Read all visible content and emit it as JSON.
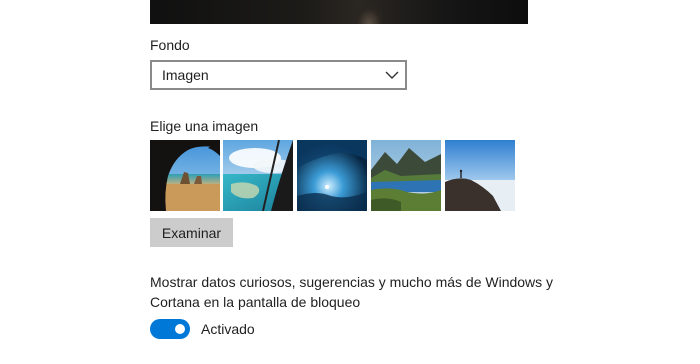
{
  "background": {
    "label": "Fondo",
    "selected": "Imagen"
  },
  "choose_image": {
    "label": "Elige una imagen",
    "thumbnails": [
      "cave-beach",
      "aerial-coast",
      "ice-cave",
      "mountain-lake",
      "sea-cliff"
    ]
  },
  "browse_button": "Examinar",
  "tips": {
    "description": "Mostrar datos curiosos, sugerencias y mucho más de Windows y Cortana en la pantalla de bloqueo",
    "toggle_state": "Activado",
    "toggle_on": true
  },
  "colors": {
    "accent": "#0078d7",
    "button_bg": "#cccccc",
    "border": "#8a8a8a"
  }
}
